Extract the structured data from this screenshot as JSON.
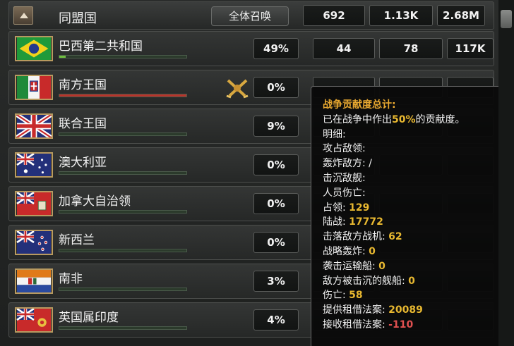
{
  "header": {
    "title": "同盟国",
    "summon_label": "全体召唤",
    "stats": [
      "692",
      "1.13K",
      "2.68M"
    ]
  },
  "countries": [
    {
      "name": "巴西第二共和国",
      "flag": "brazil-flag",
      "percent": "49%",
      "c2": "44",
      "c3": "78",
      "c4": "117K",
      "bar": 0.05,
      "bar_color": "#6fbf3f"
    },
    {
      "name": "南方王国",
      "flag": "italy-flag",
      "percent": "0%",
      "c2": "",
      "c3": "",
      "c4": "",
      "bar": 1.0,
      "bar_color": "#b8332b",
      "at_war": true
    },
    {
      "name": "联合王国",
      "flag": "uk-flag",
      "percent": "9%",
      "c2": "",
      "c3": "",
      "c4": "",
      "bar": 0.0
    },
    {
      "name": "澳大利亚",
      "flag": "australia-flag",
      "percent": "0%",
      "c2": "",
      "c3": "",
      "c4": "",
      "bar": 0.0
    },
    {
      "name": "加拿大自治领",
      "flag": "canada-flag",
      "percent": "0%",
      "c2": "",
      "c3": "",
      "c4": "",
      "bar": 0.0
    },
    {
      "name": "新西兰",
      "flag": "new-zealand-flag",
      "percent": "0%",
      "c2": "",
      "c3": "",
      "c4": "",
      "bar": 0.0
    },
    {
      "name": "南非",
      "flag": "south-africa-flag",
      "percent": "3%",
      "c2": "",
      "c3": "",
      "c4": "",
      "bar": 0.0
    },
    {
      "name": "英国属印度",
      "flag": "british-india-flag",
      "percent": "4%",
      "c2": "",
      "c3": "",
      "c4": "",
      "bar": 0.0
    }
  ],
  "tooltip": {
    "title": "战争贡献度总计:",
    "summary_prefix": "已在战争中作出",
    "summary_value": "50%",
    "summary_suffix": "的贡献度。",
    "detail_label": "明细:",
    "lines": [
      {
        "label": "攻占敌领:",
        "value": "",
        "style": "yellow"
      },
      {
        "label": "轰炸敌方:",
        "value": " /",
        "style": "plain"
      },
      {
        "label": "击沉敌舰:",
        "value": "",
        "style": "yellow"
      },
      {
        "label": "人员伤亡:",
        "value": "",
        "style": "yellow"
      },
      {
        "label": "占领:",
        "value": "129",
        "style": "yellow"
      },
      {
        "label": "陆战:",
        "value": "17772",
        "style": "yellow"
      },
      {
        "label": "击落敌方战机:",
        "value": "62",
        "style": "yellow"
      },
      {
        "label": "战略轰炸:",
        "value": "0",
        "style": "yellow"
      },
      {
        "label": "袭击运输船:",
        "value": "0",
        "style": "yellow"
      },
      {
        "label": "敌方被击沉的舰船:",
        "value": "0",
        "style": "yellow"
      },
      {
        "label": "伤亡:",
        "value": "58",
        "style": "yellow"
      },
      {
        "label": "提供租借法案:",
        "value": "20089",
        "style": "yellow"
      },
      {
        "label": "接收租借法案:",
        "value": "-110",
        "style": "red"
      }
    ]
  }
}
